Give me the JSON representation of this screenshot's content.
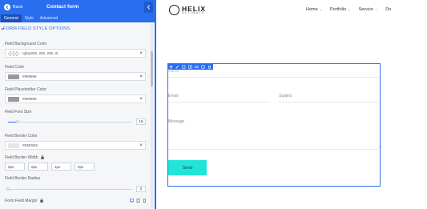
{
  "panel": {
    "back_label": "Back",
    "title": "Contact form",
    "tabs": [
      {
        "label": "General",
        "active": true
      },
      {
        "label": "Style",
        "active": false
      },
      {
        "label": "Advanced",
        "active": false
      }
    ],
    "section_title": "FORM FIELD STYLE OPTIONS",
    "fields": {
      "bg_color": {
        "label": "Field Background Color",
        "value": "rgba(255, 255, 255, 0)"
      },
      "color": {
        "label": "Field Color",
        "value": "#999999",
        "swatch": "#999999"
      },
      "placeholder_color": {
        "label": "Field Placeholder Color",
        "value": "#999999",
        "swatch": "#999999"
      },
      "font_size": {
        "label": "Field Font Size",
        "value": "16",
        "level": 0.08
      },
      "border_color": {
        "label": "Field Border Color",
        "value": "#E5E5E5",
        "swatch": "#e5e5e5"
      },
      "border_width": {
        "label": "Field Border Width",
        "values": [
          "0px",
          "0px",
          "1px",
          "0px"
        ]
      },
      "border_radius": {
        "label": "Field Border Radius",
        "value": "0",
        "level": 0.0
      },
      "margin": {
        "label": "Form Field Margin"
      }
    }
  },
  "site": {
    "logo_name": "HELIX",
    "logo_sub": "ULTIMATE",
    "nav": [
      {
        "label": "Home",
        "caret": "⌄"
      },
      {
        "label": "Portfolio",
        "caret": "⌄"
      },
      {
        "label": "Service",
        "caret": "⌄"
      },
      {
        "label": "Do",
        "caret": ""
      }
    ],
    "form": {
      "name_placeholder": "Name",
      "email_placeholder": "Email",
      "subject_placeholder": "Subject",
      "message_placeholder": "Message",
      "send_label": "Send"
    }
  },
  "colors": {
    "accent": "#2a6ef0",
    "send_button": "#22e5d8"
  }
}
